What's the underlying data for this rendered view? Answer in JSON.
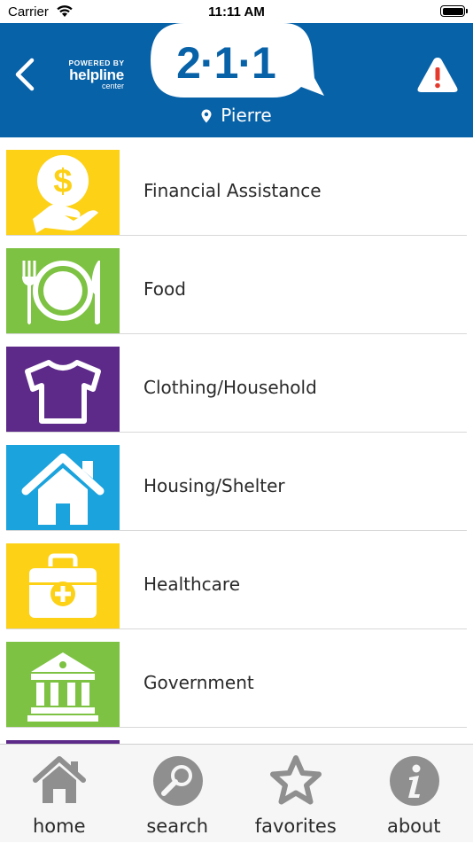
{
  "status_bar": {
    "carrier": "Carrier",
    "time": "11:11 AM"
  },
  "header": {
    "powered_by": "POWERED BY",
    "helpline": "helpline",
    "center": "center",
    "logo": "2·1·1",
    "location": "Pierre",
    "colors": {
      "bar": "#0862a8",
      "alert": "#e53a2b"
    }
  },
  "categories": [
    {
      "label": "Financial Assistance",
      "icon": "money-hand-icon",
      "color": "#fcd116"
    },
    {
      "label": "Food",
      "icon": "plate-fork-knife-icon",
      "color": "#7dc242"
    },
    {
      "label": "Clothing/Household",
      "icon": "shirt-icon",
      "color": "#5d2a8a"
    },
    {
      "label": "Housing/Shelter",
      "icon": "house-icon",
      "color": "#1aa3dd"
    },
    {
      "label": "Healthcare",
      "icon": "medical-kit-icon",
      "color": "#fcd116"
    },
    {
      "label": "Government",
      "icon": "government-building-icon",
      "color": "#7dc242"
    }
  ],
  "tabs": [
    {
      "label": "home",
      "icon": "home-icon"
    },
    {
      "label": "search",
      "icon": "search-icon"
    },
    {
      "label": "favorites",
      "icon": "star-icon"
    },
    {
      "label": "about",
      "icon": "info-icon"
    }
  ]
}
